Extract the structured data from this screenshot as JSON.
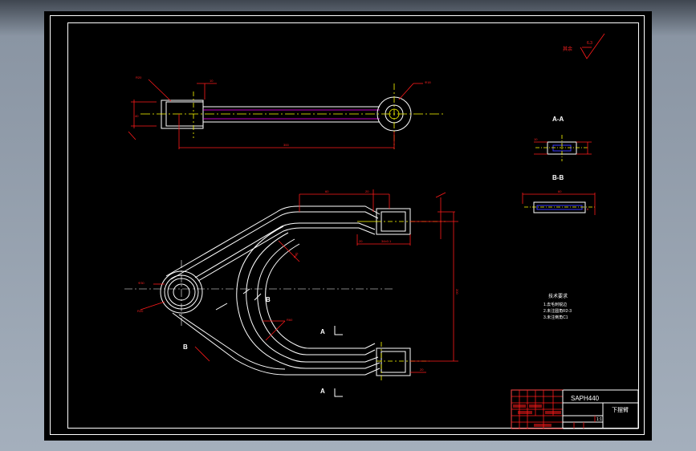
{
  "drawing": {
    "roughness_note": "其余",
    "roughness_value": "6.3",
    "section_aa": "A-A",
    "section_bb": "B-B",
    "cut_a": "A",
    "cut_b": "B",
    "tech_title": "技术要求",
    "tech_lines": [
      "1.去毛刺锐边",
      "2.未注圆角R2-3",
      "3.未注倒角C1"
    ],
    "title_block": {
      "material": "SAPH440",
      "part_name": "下摆臂",
      "scale": "1:1"
    }
  },
  "colors": {
    "background": "#000000",
    "outline": "#ffffff",
    "dimension": "#ff1a1a",
    "centerline": "#ffff00",
    "hidden": "#ff00ff",
    "section": "#3a3aff"
  }
}
